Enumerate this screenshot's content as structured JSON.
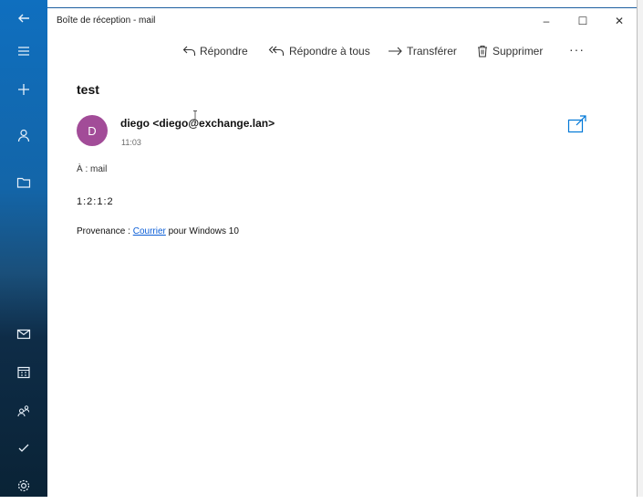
{
  "window": {
    "title": "Boîte de réception - mail",
    "minimize_label": "–",
    "maximize_label": "☐",
    "close_label": "✕"
  },
  "rail": {
    "items": [
      "back-icon",
      "menu-icon",
      "compose-icon",
      "account-icon",
      "folder-icon",
      "mail-icon",
      "calendar-icon",
      "people-icon",
      "todo-icon",
      "settings-icon"
    ]
  },
  "commands": {
    "reply": "Répondre",
    "reply_all": "Répondre à tous",
    "forward": "Transférer",
    "delete": "Supprimer",
    "more": "···"
  },
  "message": {
    "subject": "test",
    "avatar_initial": "D",
    "avatar_color": "#a24c98",
    "sender": "diego <diego@exchange.lan>",
    "time": "11:03",
    "to_line": "À : mail",
    "body": "1:2:1:2",
    "signature_prefix": "Provenance : ",
    "signature_link": "Courrier",
    "signature_suffix": " pour Windows 10"
  },
  "colors": {
    "accent": "#0078d7",
    "link": "#0b5ed7"
  }
}
